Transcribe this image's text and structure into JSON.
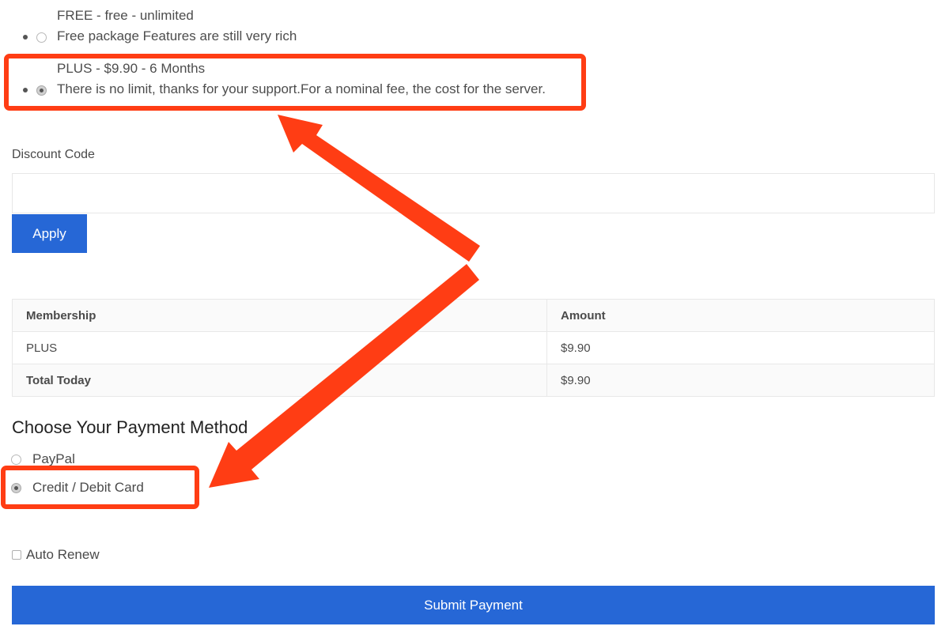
{
  "plans": [
    {
      "title": "FREE - free -  unlimited",
      "description": "Free package Features are still very rich",
      "selected": false
    },
    {
      "title": "PLUS - $9.90 -  6 Months",
      "description": "There is no limit, thanks for your support.For a nominal fee, the cost for the server.",
      "selected": true
    }
  ],
  "discount": {
    "label": "Discount Code",
    "value": "",
    "placeholder": "",
    "apply_label": "Apply"
  },
  "summary_table": {
    "headers": [
      "Membership",
      "Amount"
    ],
    "rows": [
      {
        "membership": "PLUS",
        "amount": "$9.90"
      },
      {
        "membership": "Total Today",
        "amount": "$9.90"
      }
    ]
  },
  "payment": {
    "title": "Choose Your Payment Method",
    "options": [
      {
        "label": "PayPal",
        "selected": false
      },
      {
        "label": "Credit / Debit Card",
        "selected": true
      }
    ]
  },
  "auto_renew": {
    "label": "Auto Renew",
    "checked": false
  },
  "submit_label": "Submit Payment",
  "colors": {
    "accent": "#2667d6",
    "annotation": "#ff3d14"
  }
}
